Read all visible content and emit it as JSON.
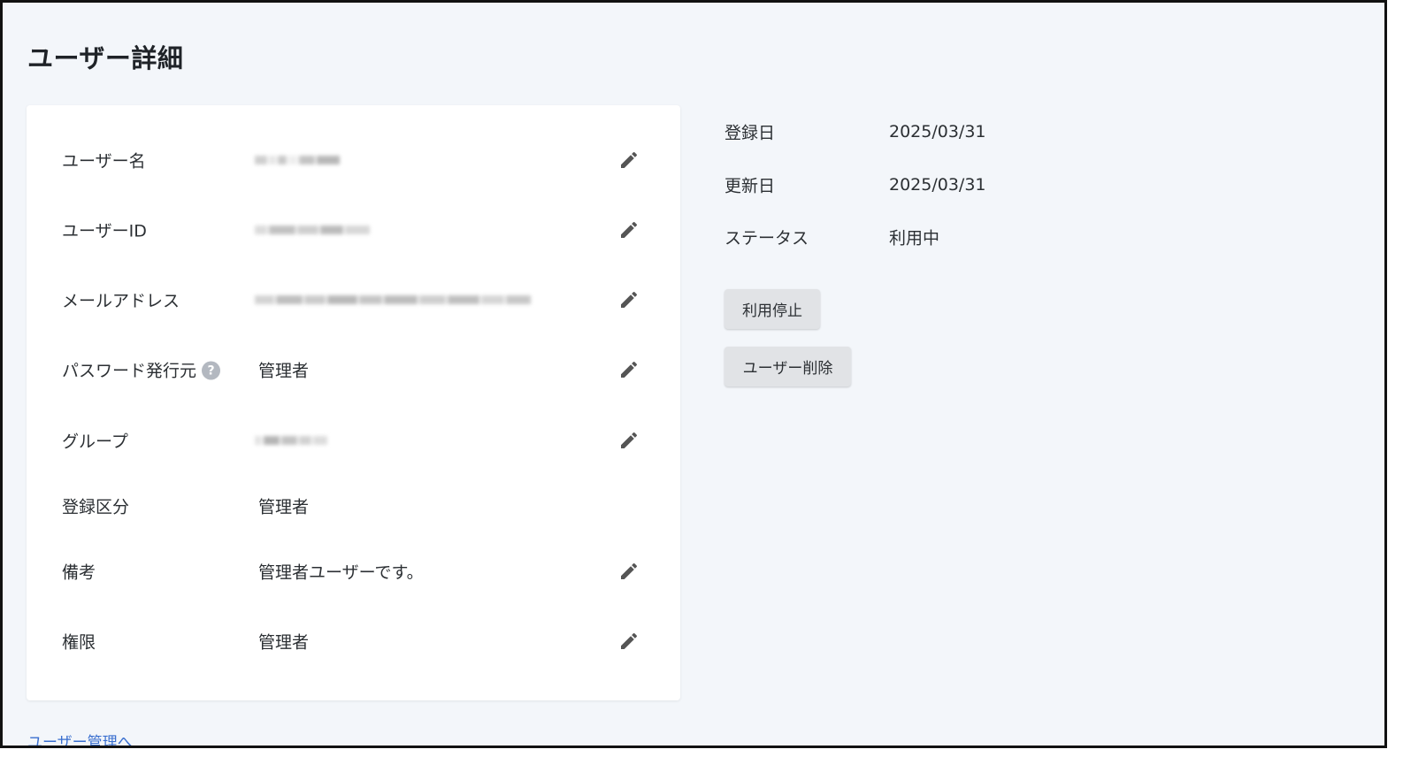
{
  "page": {
    "title": "ユーザー詳細"
  },
  "details": {
    "rows": [
      {
        "label": "ユーザー名",
        "value": "",
        "masked": true,
        "editable": true
      },
      {
        "label": "ユーザーID",
        "value": "",
        "masked": true,
        "editable": true
      },
      {
        "label": "メールアドレス",
        "value": "",
        "masked": true,
        "editable": true
      },
      {
        "label": "パスワード発行元",
        "value": "管理者",
        "help_icon": "?",
        "editable": true
      },
      {
        "label": "グループ",
        "value": "",
        "masked": true,
        "editable": true
      },
      {
        "label": "登録区分",
        "value": "管理者",
        "editable": false
      },
      {
        "label": "備考",
        "value": "管理者ユーザーです。",
        "editable": true
      },
      {
        "label": "権限",
        "value": "管理者",
        "editable": true
      }
    ],
    "edit_icon": "pencil-icon"
  },
  "meta": {
    "registered_label": "登録日",
    "registered_value": "2025/03/31",
    "updated_label": "更新日",
    "updated_value": "2025/03/31",
    "status_label": "ステータス",
    "status_value": "利用中"
  },
  "actions": {
    "suspend_label": "利用停止",
    "delete_label": "ユーザー削除"
  },
  "footer": {
    "back_link": "ユーザー管理へ"
  },
  "colors": {
    "background": "#f3f6fa",
    "card": "#ffffff",
    "link": "#3a6fcf",
    "button": "#e1e3e6",
    "icon": "#555555"
  }
}
